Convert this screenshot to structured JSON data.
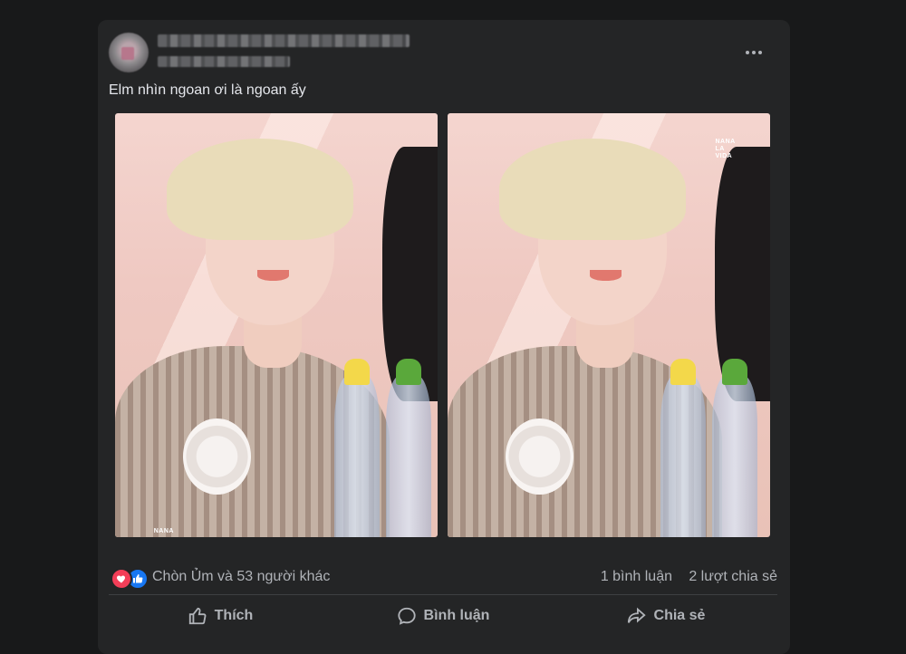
{
  "post": {
    "text": "Elm nhìn ngoan ơi là ngoan ấy"
  },
  "photos": [
    {
      "watermark": "NANA"
    },
    {
      "watermark": "NANA\nLA\nVIDA"
    }
  ],
  "stats": {
    "reactors": "Chòn Ủm và 53 người khác",
    "comments": "1 bình luận",
    "shares": "2 lượt chia sẻ"
  },
  "actions": {
    "like": "Thích",
    "comment": "Bình luận",
    "share": "Chia sẻ"
  },
  "colors": {
    "page_bg": "#18191a",
    "card_bg": "#242526",
    "love": "#f33e58",
    "like": "#1877f2",
    "secondary_text": "#b0b3b8"
  }
}
